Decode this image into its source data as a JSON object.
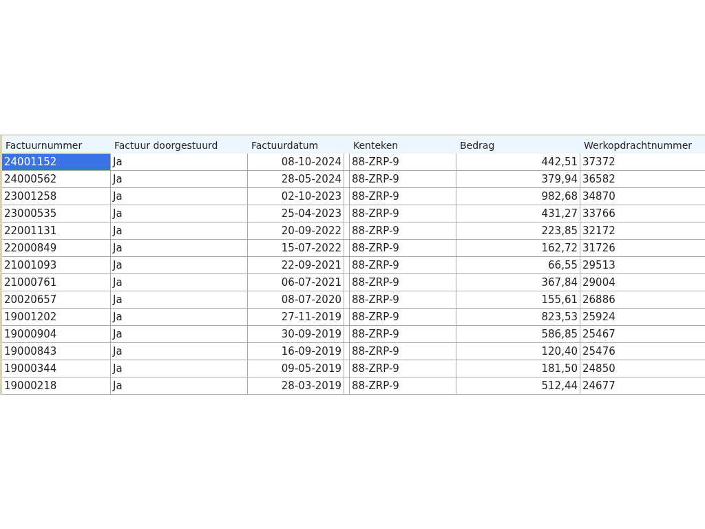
{
  "table": {
    "columns": [
      "Factuurnummer",
      "Factuur doorgestuurd",
      "Factuurdatum",
      "Kenteken",
      "Bedrag",
      "Werkopdrachtnummer"
    ],
    "rows": [
      {
        "selected": true,
        "cells": [
          "24001152",
          "Ja",
          "08-10-2024",
          "88-ZRP-9",
          "442,51",
          "37372"
        ]
      },
      {
        "selected": false,
        "cells": [
          "24000562",
          "Ja",
          "28-05-2024",
          "88-ZRP-9",
          "379,94",
          "36582"
        ]
      },
      {
        "selected": false,
        "cells": [
          "23001258",
          "Ja",
          "02-10-2023",
          "88-ZRP-9",
          "982,68",
          "34870"
        ]
      },
      {
        "selected": false,
        "cells": [
          "23000535",
          "Ja",
          "25-04-2023",
          "88-ZRP-9",
          "431,27",
          "33766"
        ]
      },
      {
        "selected": false,
        "cells": [
          "22001131",
          "Ja",
          "20-09-2022",
          "88-ZRP-9",
          "223,85",
          "32172"
        ]
      },
      {
        "selected": false,
        "cells": [
          "22000849",
          "Ja",
          "15-07-2022",
          "88-ZRP-9",
          "162,72",
          "31726"
        ]
      },
      {
        "selected": false,
        "cells": [
          "21001093",
          "Ja",
          "22-09-2021",
          "88-ZRP-9",
          "66,55",
          "29513"
        ]
      },
      {
        "selected": false,
        "cells": [
          "21000761",
          "Ja",
          "06-07-2021",
          "88-ZRP-9",
          "367,84",
          "29004"
        ]
      },
      {
        "selected": false,
        "cells": [
          "20020657",
          "Ja",
          "08-07-2020",
          "88-ZRP-9",
          "155,61",
          "26886"
        ]
      },
      {
        "selected": false,
        "cells": [
          "19001202",
          "Ja",
          "27-11-2019",
          "88-ZRP-9",
          "823,53",
          "25924"
        ]
      },
      {
        "selected": false,
        "cells": [
          "19000904",
          "Ja",
          "30-09-2019",
          "88-ZRP-9",
          "586,85",
          "25467"
        ]
      },
      {
        "selected": false,
        "cells": [
          "19000843",
          "Ja",
          "16-09-2019",
          "88-ZRP-9",
          "120,40",
          "25476"
        ]
      },
      {
        "selected": false,
        "cells": [
          "19000344",
          "Ja",
          "09-05-2019",
          "88-ZRP-9",
          "181,50",
          "24850"
        ]
      },
      {
        "selected": false,
        "cells": [
          "19000218",
          "Ja",
          "28-03-2019",
          "88-ZRP-9",
          "512,44",
          "24677"
        ]
      }
    ]
  }
}
